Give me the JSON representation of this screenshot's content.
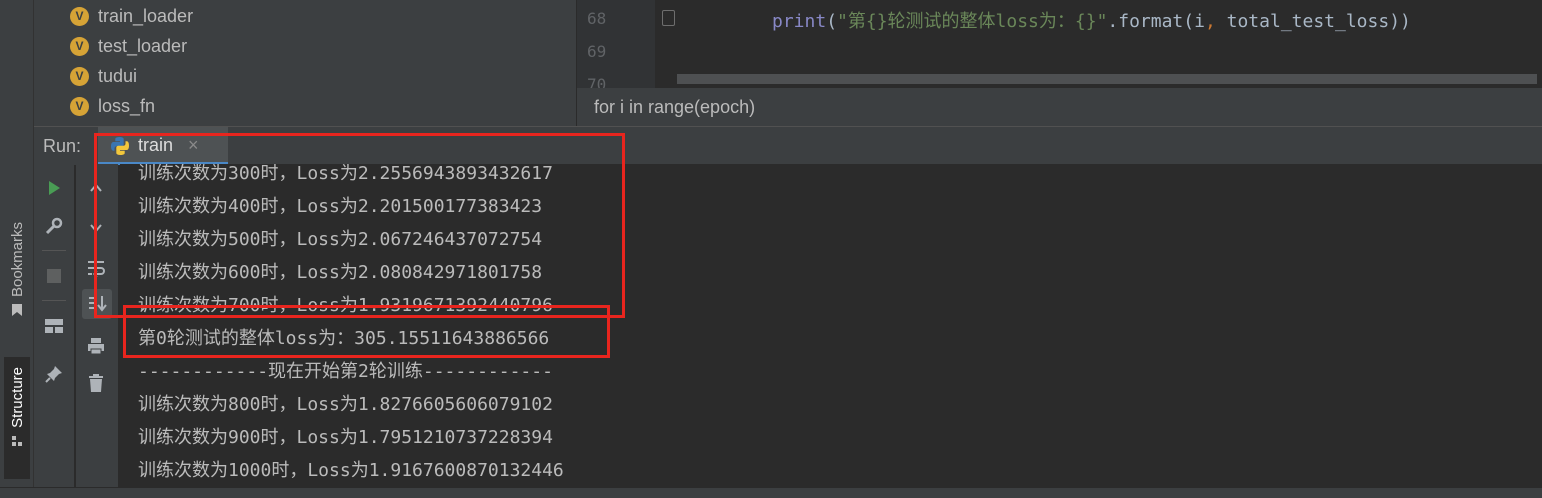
{
  "side_tabs": [
    {
      "label": "Bookmarks"
    },
    {
      "label": "Structure"
    }
  ],
  "structure": {
    "items": [
      {
        "badge": "V",
        "label": "train_loader"
      },
      {
        "badge": "V",
        "label": "test_loader"
      },
      {
        "badge": "V",
        "label": "tudui"
      },
      {
        "badge": "V",
        "label": "loss_fn"
      }
    ]
  },
  "editor": {
    "line_numbers": [
      "68",
      "69",
      "70"
    ],
    "code": {
      "fn": "print",
      "open": "(",
      "str": "\"第{}轮测试的整体loss为：{}\"",
      "rest": ".format(i",
      "comma": ",",
      "tail": " total_test_loss))"
    },
    "breadcrumb": "for i in range(epoch)"
  },
  "run_panel": {
    "label": "Run:",
    "tab_label": "train",
    "tab_close": "×"
  },
  "console": {
    "lines": [
      "训练次数为300时，Loss为2.2556943893432617",
      "训练次数为400时，Loss为2.201500177383423",
      "训练次数为500时，Loss为2.067246437072754",
      "训练次数为600时，Loss为2.080842971801758",
      "训练次数为700时，Loss为1.9319671392440796",
      "第0轮测试的整体loss为：305.15511643886566",
      "------------现在开始第2轮训练------------",
      "训练次数为800时，Loss为1.8276605606079102",
      "训练次数为900时，Loss为1.7951210737228394",
      "训练次数为1000时，Loss为1.9167600870132446"
    ]
  },
  "colors": {
    "highlight": "#e8251e",
    "accent": "#4a88c7",
    "run_green": "#499c54"
  },
  "icons": [
    "python-icon",
    "run-icon",
    "wrench-icon",
    "stop-icon",
    "layout-icon",
    "pin-icon",
    "arrow-up-icon",
    "arrow-down-icon",
    "soft-wrap-icon",
    "scroll-to-end-icon",
    "print-icon",
    "trash-icon",
    "bookmark-icon",
    "structure-icon"
  ]
}
